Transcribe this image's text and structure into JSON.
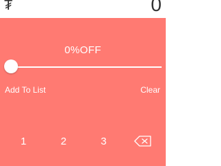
{
  "header": {
    "currency_symbol": "₮",
    "amount": "0"
  },
  "discount": {
    "label": "0%OFF",
    "slider_value": 0
  },
  "actions": {
    "add_to_list": "Add To List",
    "clear": "Clear"
  },
  "keypad": {
    "keys": [
      "1",
      "2",
      "3"
    ],
    "backspace_icon": "backspace-icon"
  },
  "colors": {
    "background": "#FF7A72",
    "header_background": "#FFFFFF",
    "text": "#FFFFFF"
  }
}
